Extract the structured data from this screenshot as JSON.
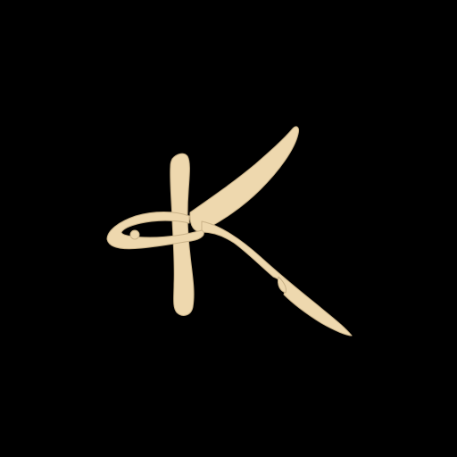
{
  "logo": {
    "letter": "K",
    "description_icon": "calligraphic-k-logo-icon",
    "colors": {
      "background": "#000000",
      "ink": "#EED8AE",
      "ink_shadow": "#C9B288"
    }
  }
}
